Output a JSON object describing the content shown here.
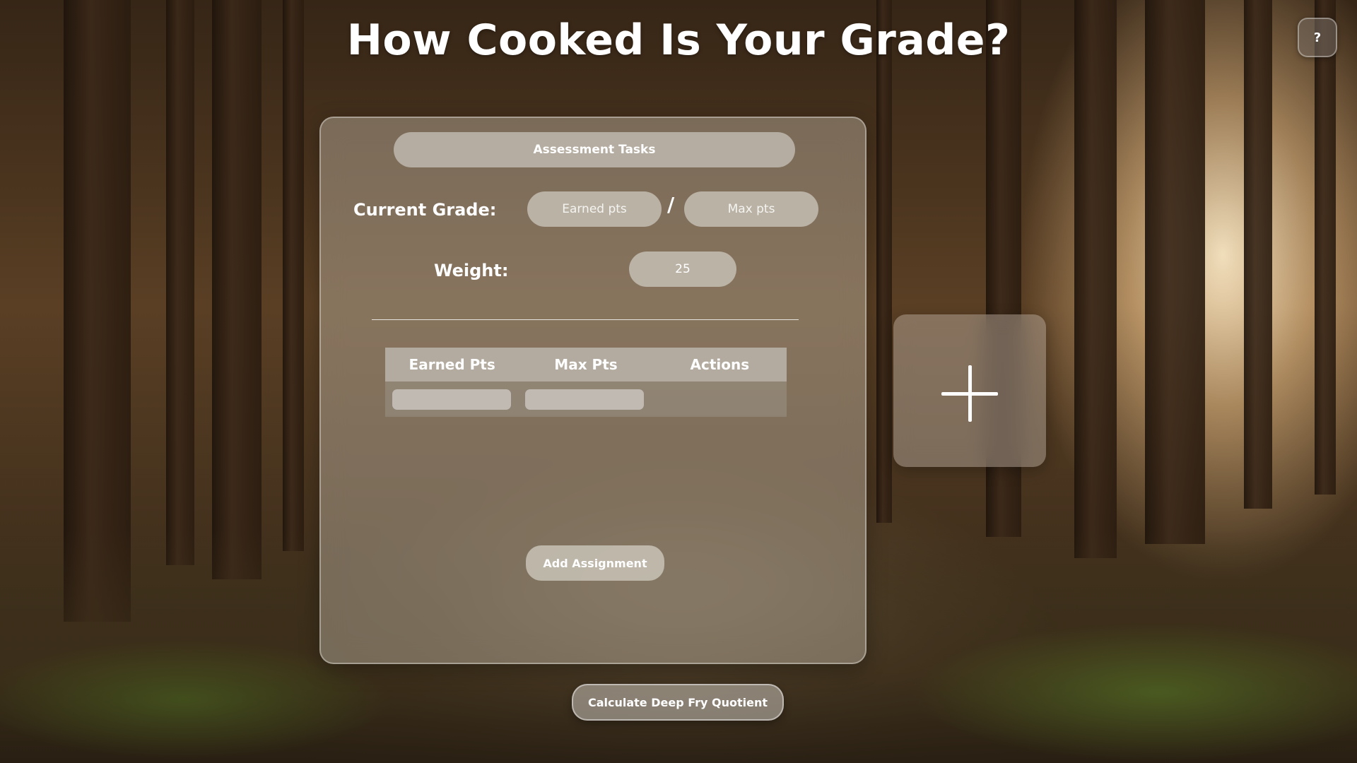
{
  "page": {
    "title": "How Cooked Is Your Grade?",
    "help_label": "?"
  },
  "panel": {
    "tasks_header": "Assessment Tasks",
    "grade_label": "Current Grade:",
    "earned_placeholder": "Earned pts",
    "separator": "/",
    "max_placeholder": "Max pts",
    "weight_label": "Weight:",
    "weight_value": "25",
    "table": {
      "columns": [
        "Earned Pts",
        "Max Pts",
        "Actions"
      ],
      "rows": [
        {
          "earned": "",
          "max": ""
        }
      ]
    },
    "add_assignment_label": "Add Assignment"
  },
  "add_card": {
    "icon": "plus-icon"
  },
  "footer": {
    "calculate_label": "Calculate Deep Fry Quotient"
  },
  "colors": {
    "text": "#ffffff",
    "glass": "#c8beaf"
  }
}
